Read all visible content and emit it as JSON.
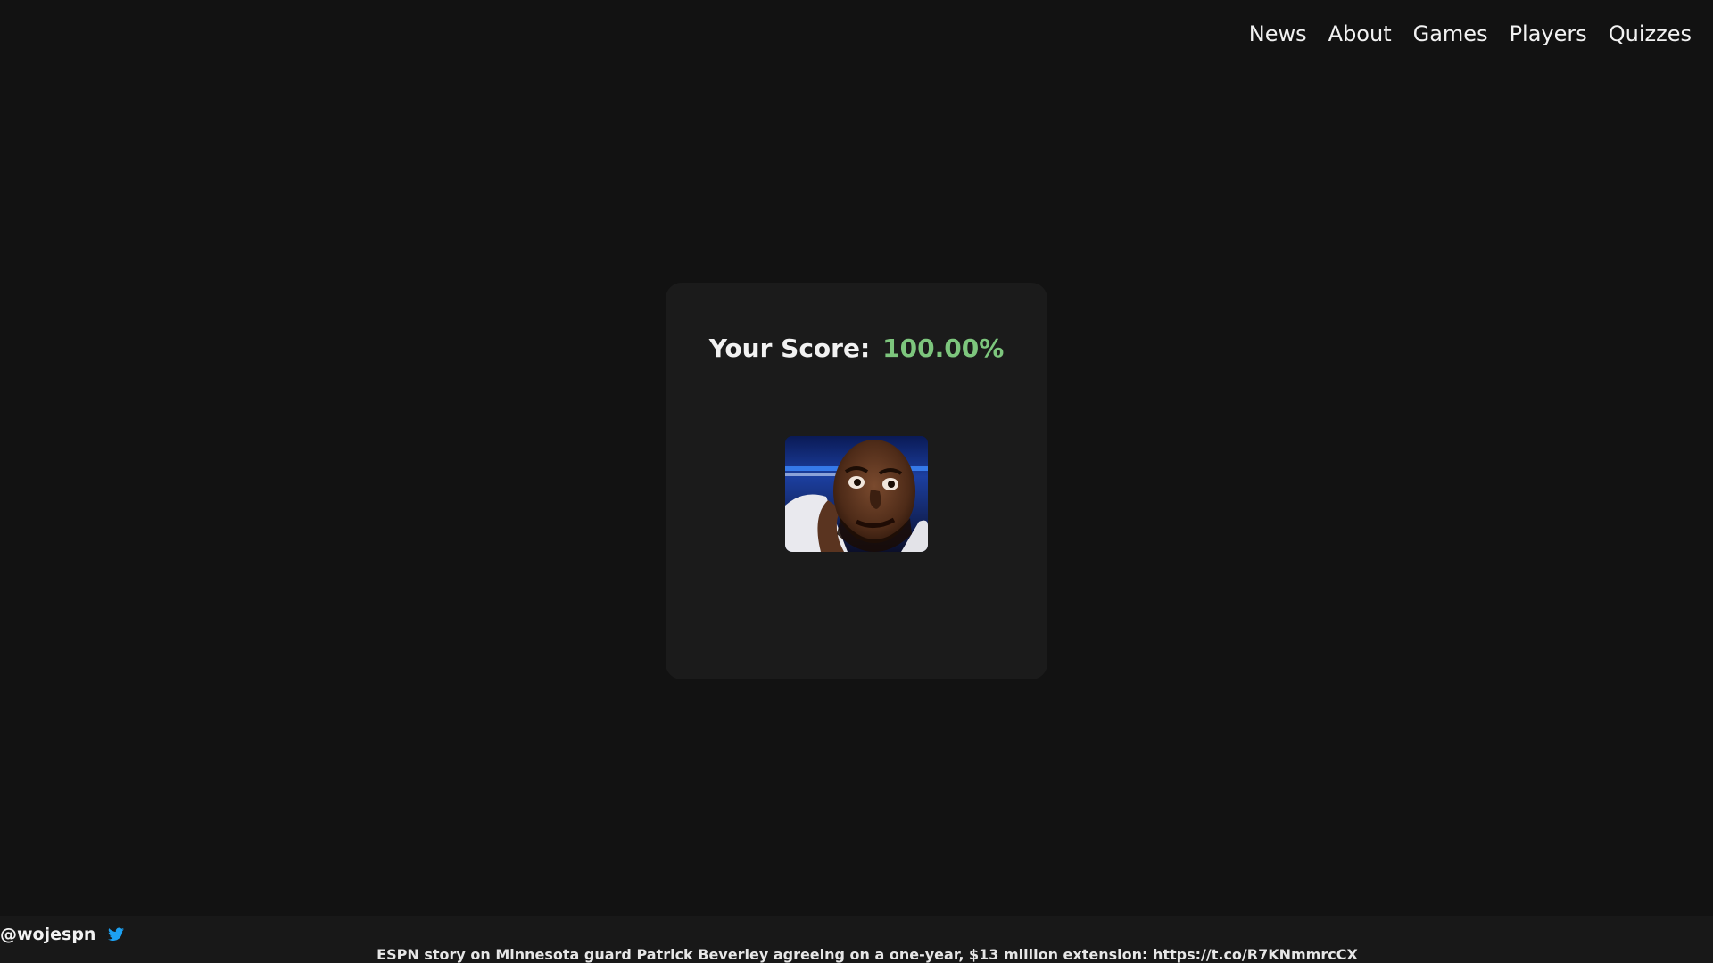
{
  "nav": {
    "items": [
      "News",
      "About",
      "Games",
      "Players",
      "Quizzes"
    ]
  },
  "score": {
    "label": "Your Score:",
    "value": "100.00%",
    "value_color": "#7dc67d"
  },
  "image": {
    "icon": "player-reaction-image"
  },
  "footer": {
    "handle": "@wojespn",
    "icon": "twitter-icon",
    "icon_color": "#1da1f2",
    "tweet": "ESPN story on Minnesota guard Patrick Beverley agreeing on a one-year, $13 million extension: https://t.co/R7KNmmrcCX"
  }
}
